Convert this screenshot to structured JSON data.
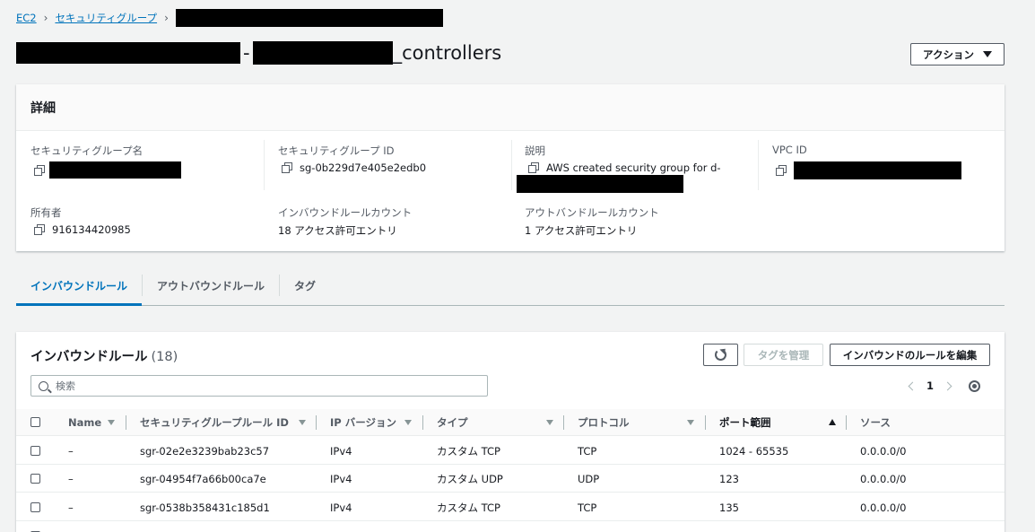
{
  "breadcrumb": {
    "root": "EC2",
    "section": "セキュリティグループ"
  },
  "title": {
    "suffix": "_controllers",
    "dash": "-"
  },
  "actions_label": "アクション",
  "details": {
    "heading": "詳細",
    "sg_name_label": "セキュリティグループ名",
    "sg_id_label": "セキュリティグループ ID",
    "sg_id_value": "sg-0b229d7e405e2edb0",
    "description_label": "説明",
    "description_value": "AWS created security group for d-",
    "vpc_label": "VPC ID",
    "owner_label": "所有者",
    "owner_value": "916134420985",
    "inbound_count_label": "インバウンドルールカウント",
    "inbound_count_value": "18 アクセス許可エントリ",
    "outbound_count_label": "アウトバンドルールカウント",
    "outbound_count_value": "1 アクセス許可エントリ"
  },
  "tabs": [
    "インバウンドルール",
    "アウトバウンドルール",
    "タグ"
  ],
  "rules": {
    "title": "インバウンドルール",
    "count": "(18)",
    "manage_tags": "タグを管理",
    "edit_rules": "インバウンドのルールを編集",
    "search_placeholder": "検索",
    "page": "1",
    "columns": [
      "Name",
      "セキュリティグループルール ID",
      "IP バージョン",
      "タイプ",
      "プロトコル",
      "ポート範囲",
      "ソース"
    ],
    "rows": [
      [
        "–",
        "sgr-02e2e3239bab23c57",
        "IPv4",
        "カスタム TCP",
        "TCP",
        "1024 - 65535",
        "0.0.0.0/0"
      ],
      [
        "–",
        "sgr-04954f7a66b00ca7e",
        "IPv4",
        "カスタム UDP",
        "UDP",
        "123",
        "0.0.0.0/0"
      ],
      [
        "–",
        "sgr-0538b358431c185d1",
        "IPv4",
        "カスタム TCP",
        "TCP",
        "135",
        "0.0.0.0/0"
      ]
    ]
  }
}
